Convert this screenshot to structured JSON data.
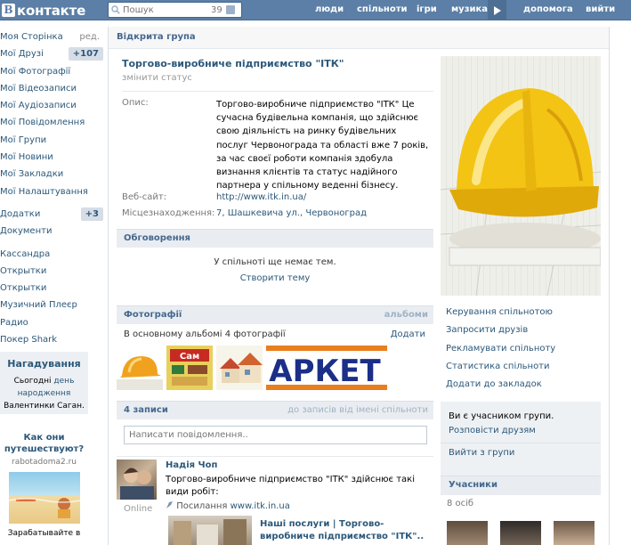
{
  "header": {
    "logo_letter": "В",
    "logo_text": "контакте",
    "search_placeholder": "Пошук",
    "search_count": "39",
    "nav": [
      "люди",
      "спільноти",
      "ігри",
      "музика",
      "допомога",
      "вийти"
    ],
    "brand_color": "#5B7FA6"
  },
  "leftnav": {
    "items": [
      {
        "label": "Моя Сторінка",
        "extra": "ред."
      },
      {
        "label": "Мої Друзі",
        "badge": "+107"
      },
      {
        "label": "Мої Фотографії"
      },
      {
        "label": "Мої Відеозаписи"
      },
      {
        "label": "Мої Аудіозаписи"
      },
      {
        "label": "Мої Повідомлення"
      },
      {
        "label": "Мої Групи"
      },
      {
        "label": "Мої Новини"
      },
      {
        "label": "Мої Закладки"
      },
      {
        "label": "Мої Налаштування"
      }
    ],
    "apps": [
      {
        "label": "Додатки",
        "badge": "+3"
      },
      {
        "label": "Документи"
      }
    ],
    "extras": [
      "Кассандра",
      "Открытки",
      "Открытки",
      "Музичний Плеєр",
      "Радио",
      "Покер Shark"
    ]
  },
  "reminder": {
    "title": "Нагадування",
    "line1": "Сьогодні",
    "link": "день народження",
    "line2": "Валентинки Саган."
  },
  "ad": {
    "question": "Как они путешествуют?",
    "domain": "rabotadoma2.ru",
    "text": "Зарабатывайте в"
  },
  "group": {
    "breadcrumb": "Відкрита група",
    "name": "Торгово-виробниче підприємство \"ІТК\"",
    "change_status": "змінити статус",
    "desc_label": "Опис:",
    "description": "Торгово-виробниче підприємство \"ІТК\" Це сучасна будівельна компанія, що здійснює свою діяльність на ринку будівельних послуг Червонограда та області вже 7 років, за час своєї роботи компанія здобула визнання клієнтів та статус надійного партнера у спільному веденні бізнесу.",
    "site_label": "Веб-сайт:",
    "site": "http://www.itk.in.ua/",
    "loc_label": "Місцезнаходження:",
    "location": "7, Шашкевича ул., Червоноград"
  },
  "discussions": {
    "title": "Обговорення",
    "empty": "У спільноті ще немає тем.",
    "create": "Створити тему"
  },
  "photos": {
    "title": "Фотографії",
    "link": "альбоми",
    "album_text": "В основному альбомі 4 фотографії",
    "add": "Додати",
    "thumb4_text": "АРКЕТ",
    "thumb2_text": "Сам"
  },
  "wall": {
    "count": "4 записи",
    "filter": "до записів від імені спільноти",
    "placeholder": "Написати повідомлення..",
    "post": {
      "author": "Надія Чоп",
      "online": "Online",
      "text": "Торгово-виробниче підприємство \"ІТК\" здійснює такі види робіт:",
      "link_prefix": "Посилання",
      "link_url": "www.itk.in.ua",
      "attachment_title": "Наші послуги | Торгово-виробниче підприємство \"ІТК\".."
    }
  },
  "actions": [
    "Керування спільнотою",
    "Запросити друзів",
    "Рекламувати спільноту",
    "Статистика спільноти",
    "Додати до закладок"
  ],
  "membership": {
    "question": "Ви є учасником групи.",
    "invite": "Розповісти друзям",
    "leave": "Вийти з групи"
  },
  "members": {
    "title": "Учасники",
    "count": "8 осіб"
  }
}
